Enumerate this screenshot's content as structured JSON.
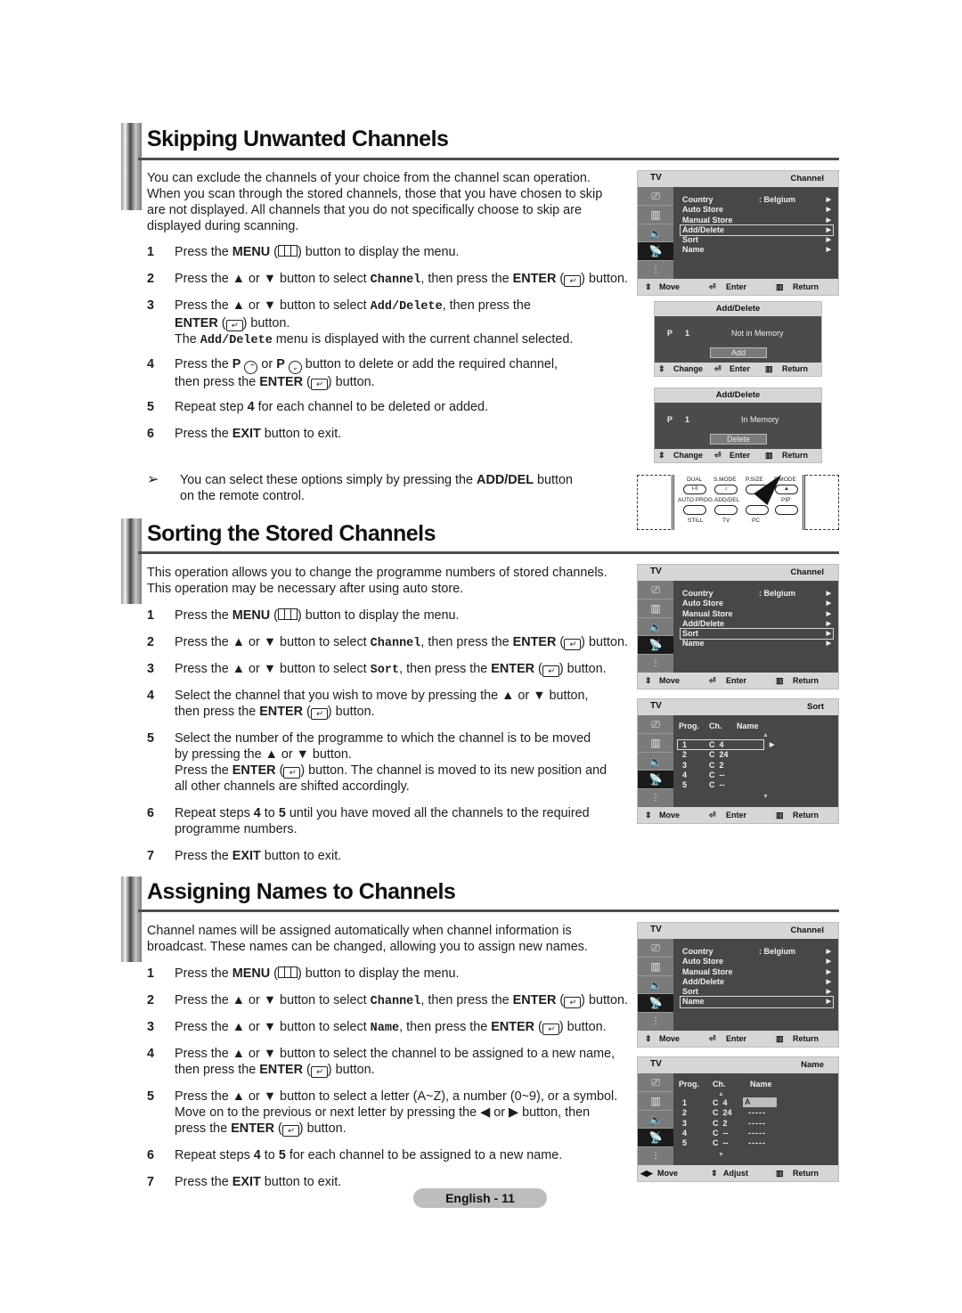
{
  "sections": [
    {
      "title": "Skipping Unwanted Channels",
      "intro": [
        "You can exclude the channels of your choice from the channel scan operation.",
        "When you scan through the stored channels, those that you have chosen to skip",
        "are not displayed. All channels that you do not specifically choose to skip are",
        "displayed during scanning."
      ],
      "steps": [
        {
          "num": "1",
          "lines": [
            "Press the <b>MENU</b> (<i class=\"ic-menu\"></i>) button to display the menu."
          ]
        },
        {
          "num": "2",
          "lines": [
            "Press the ▲ or ▼ button to select <span class=\"mono\">Channel</span>, then press the <b>ENTER</b> (<i class=\"ic-enter\">↵</i>) button."
          ]
        },
        {
          "num": "3",
          "lines": [
            "Press the ▲ or ▼ button to select <span class=\"mono\">Add/Delete</span>, then press the",
            "<b>ENTER</b> (<i class=\"ic-enter\">↵</i>) button.",
            "The <span class=\"mono\">Add/Delete</span> menu is displayed with the current channel selected."
          ]
        },
        {
          "num": "4",
          "lines": [
            "Press the <b>P</b> <i class=\"ic-pcircle\">⌃</i> or <b>P</b> <i class=\"ic-pcircle\">⌄</i> button to delete or add the required channel,",
            "then press the <b>ENTER</b> (<i class=\"ic-enter\">↵</i>) button."
          ]
        },
        {
          "num": "5",
          "lines": [
            "Repeat step <b>4</b> for each channel to be deleted or added."
          ]
        },
        {
          "num": "6",
          "lines": [
            "Press the <b>EXIT</b> button to exit."
          ]
        }
      ],
      "note": [
        "You can select these options simply by pressing the <b>ADD/DEL</b> button",
        "on the remote control."
      ]
    },
    {
      "title": "Sorting the Stored Channels",
      "intro": [
        "This operation allows you to change the programme numbers of stored channels.",
        "This operation may be necessary after using auto store."
      ],
      "steps": [
        {
          "num": "1",
          "lines": [
            "Press the <b>MENU</b> (<i class=\"ic-menu\"></i>) button to display the menu."
          ]
        },
        {
          "num": "2",
          "lines": [
            "Press the ▲ or ▼ button to select <span class=\"mono\">Channel</span>, then press the <b>ENTER</b> (<i class=\"ic-enter\">↵</i>) button."
          ]
        },
        {
          "num": "3",
          "lines": [
            "Press the ▲ or ▼ button to select <span class=\"mono\">Sort</span>, then press the <b>ENTER</b> (<i class=\"ic-enter\">↵</i>) button."
          ]
        },
        {
          "num": "4",
          "lines": [
            "Select the channel that you wish to move by pressing the ▲ or ▼ button,",
            "then press the <b>ENTER</b> (<i class=\"ic-enter\">↵</i>) button."
          ]
        },
        {
          "num": "5",
          "lines": [
            "Select the number of the programme to which the channel is to be moved",
            "by pressing the ▲ or ▼ button.",
            "Press the <b>ENTER</b> (<i class=\"ic-enter\">↵</i>) button. The channel is moved to its new position and",
            "all other channels are shifted accordingly."
          ]
        },
        {
          "num": "6",
          "lines": [
            "Repeat steps <b>4</b> to <b>5</b> until you have moved all the channels to the required",
            "programme numbers."
          ]
        },
        {
          "num": "7",
          "lines": [
            "Press the <b>EXIT</b> button to exit."
          ]
        }
      ]
    },
    {
      "title": "Assigning Names to Channels",
      "intro": [
        "Channel names will be assigned automatically when channel information is",
        "broadcast. These names can be changed, allowing you to assign new names."
      ],
      "steps": [
        {
          "num": "1",
          "lines": [
            "Press the <b>MENU</b> (<i class=\"ic-menu\"></i>) button to display the menu."
          ]
        },
        {
          "num": "2",
          "lines": [
            "Press the ▲ or ▼ button to select <span class=\"mono\">Channel</span>, then press the <b>ENTER</b> (<i class=\"ic-enter\">↵</i>) button."
          ]
        },
        {
          "num": "3",
          "lines": [
            "Press the ▲ or ▼ button to select <span class=\"mono\">Name</span>, then press the <b>ENTER</b> (<i class=\"ic-enter\">↵</i>) button."
          ]
        },
        {
          "num": "4",
          "lines": [
            "Press the ▲ or ▼ button to select the channel to be assigned to a new name,",
            "then press the <b>ENTER</b> (<i class=\"ic-enter\">↵</i>) button."
          ]
        },
        {
          "num": "5",
          "lines": [
            "Press the ▲ or ▼ button to select a letter (A~Z), a number (0~9), or a symbol.",
            "Move on to the previous or next letter by pressing the ◀ or ▶ button, then",
            "press the <b>ENTER</b> (<i class=\"ic-enter\">↵</i>) button."
          ]
        },
        {
          "num": "6",
          "lines": [
            "Repeat steps <b>4</b> to <b>5</b> for each channel to be assigned to a new name."
          ]
        },
        {
          "num": "7",
          "lines": [
            "Press the <b>EXIT</b> button to exit."
          ]
        }
      ]
    }
  ],
  "osd": {
    "tv_label": "TV",
    "channel_title": "Channel",
    "menu_items": [
      {
        "label": "Country",
        "value": ": Belgium"
      },
      {
        "label": "Auto Store",
        "value": ""
      },
      {
        "label": "Manual Store",
        "value": ""
      },
      {
        "label": "Add/Delete",
        "value": ""
      },
      {
        "label": "Sort",
        "value": ""
      },
      {
        "label": "Name",
        "value": ""
      }
    ],
    "side_icons": [
      "input-icon",
      "picture-icon",
      "sound-icon",
      "channel-icon",
      "setup-icon"
    ],
    "bottom_move": "Move",
    "bottom_enter": "Enter",
    "bottom_return": "Return",
    "bottom_adjust": "Adjust",
    "add_delete": {
      "title": "Add/Delete",
      "p_label": "P",
      "p_value": "1",
      "screen1_status": "Not in Memory",
      "screen1_button": "Add",
      "screen2_status": "In Memory",
      "screen2_button": "Delete",
      "change": "Change"
    },
    "sort": {
      "title": "Sort",
      "col_prog": "Prog.",
      "col_ch": "Ch.",
      "col_name": "Name",
      "rows": [
        {
          "prog": "1",
          "ch": "C  4"
        },
        {
          "prog": "2",
          "ch": "C  24"
        },
        {
          "prog": "3",
          "ch": "C  2"
        },
        {
          "prog": "4",
          "ch": "C  --"
        },
        {
          "prog": "5",
          "ch": "C  --"
        }
      ]
    },
    "name": {
      "title": "Name",
      "rows": [
        {
          "prog": "1",
          "ch": "C  4",
          "name": "A"
        },
        {
          "prog": "2",
          "ch": "C  24",
          "name": "-----"
        },
        {
          "prog": "3",
          "ch": "C  2",
          "name": "-----"
        },
        {
          "prog": "4",
          "ch": "C  --",
          "name": "-----"
        },
        {
          "prog": "5",
          "ch": "C  --",
          "name": "-----"
        }
      ]
    }
  },
  "remote": {
    "row1": [
      "DUAL",
      "S.MODE",
      "P.SIZE",
      "P.MODE"
    ],
    "row1_btn": [
      "I-II",
      "♪",
      "",
      "▲"
    ],
    "row2": [
      "AUTO PROG.",
      "ADD/DEL",
      "",
      "PIP"
    ],
    "row3": [
      "STILL",
      "TV",
      "PC"
    ]
  },
  "footer": {
    "page_label": "English - 11"
  }
}
